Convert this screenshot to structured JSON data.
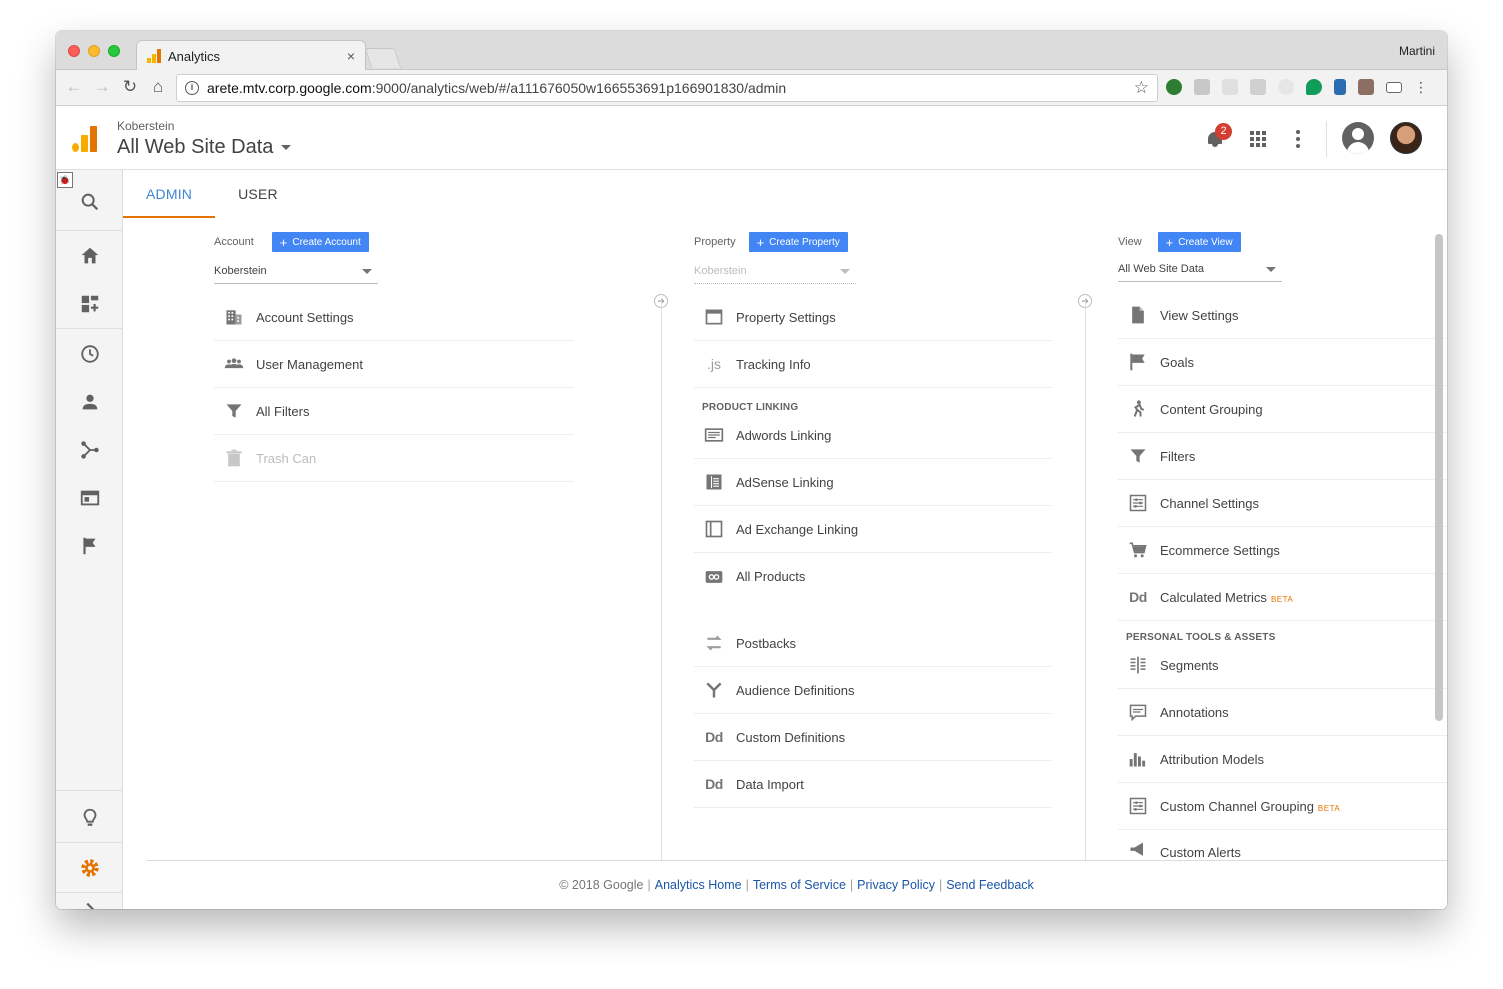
{
  "browser": {
    "tab_title": "Analytics",
    "tab_close": "×",
    "profile_name": "Martini",
    "url_host": "arete.mtv.corp.google.com",
    "url_rest": ":9000/analytics/web/#/a111676050w166553691p166901830/admin",
    "icons": [
      "back-icon",
      "forward-icon",
      "reload-icon",
      "home-icon",
      "info-icon",
      "star-icon"
    ]
  },
  "header": {
    "account_name": "Koberstein",
    "property_view": "All Web Site Data",
    "notification_count": "2"
  },
  "tabs": [
    {
      "label": "ADMIN",
      "active": true
    },
    {
      "label": "USER",
      "active": false
    }
  ],
  "account": {
    "label": "Account",
    "create_label": "Create Account",
    "selected": "Koberstein",
    "items": [
      {
        "label": "Account Settings",
        "icon": "building-icon"
      },
      {
        "label": "User Management",
        "icon": "people-icon"
      },
      {
        "label": "All Filters",
        "icon": "filter-icon"
      },
      {
        "label": "Trash Can",
        "icon": "trash-icon",
        "disabled": true
      }
    ]
  },
  "property": {
    "label": "Property",
    "create_label": "Create Property",
    "selected": "Koberstein",
    "items": [
      {
        "label": "Property Settings",
        "icon": "window-icon"
      },
      {
        "label": "Tracking Info",
        "icon": "js-icon"
      }
    ],
    "section_label": "PRODUCT LINKING",
    "linking": [
      {
        "label": "Adwords Linking",
        "icon": "adwords-icon"
      },
      {
        "label": "AdSense Linking",
        "icon": "adsense-icon"
      },
      {
        "label": "Ad Exchange Linking",
        "icon": "adexchange-icon"
      },
      {
        "label": "All Products",
        "icon": "link-icon"
      }
    ],
    "more": [
      {
        "label": "Postbacks",
        "icon": "postback-icon"
      },
      {
        "label": "Audience Definitions",
        "icon": "audience-icon"
      },
      {
        "label": "Custom Definitions",
        "icon": "dd-icon"
      },
      {
        "label": "Data Import",
        "icon": "dd-icon"
      }
    ]
  },
  "view": {
    "label": "View",
    "create_label": "Create View",
    "selected": "All Web Site Data",
    "items": [
      {
        "label": "View Settings",
        "icon": "document-icon"
      },
      {
        "label": "Goals",
        "icon": "flag-icon"
      },
      {
        "label": "Content Grouping",
        "icon": "person-walk-icon"
      },
      {
        "label": "Filters",
        "icon": "filter-icon"
      },
      {
        "label": "Channel Settings",
        "icon": "channel-icon"
      },
      {
        "label": "Ecommerce Settings",
        "icon": "cart-icon"
      },
      {
        "label": "Calculated Metrics",
        "icon": "dd-icon",
        "badge": "BETA"
      }
    ],
    "section_label": "PERSONAL TOOLS & ASSETS",
    "tools": [
      {
        "label": "Segments",
        "icon": "segments-icon"
      },
      {
        "label": "Annotations",
        "icon": "comment-icon"
      },
      {
        "label": "Attribution Models",
        "icon": "bars-icon"
      },
      {
        "label": "Custom Channel Grouping",
        "icon": "channel-icon",
        "badge": "BETA"
      },
      {
        "label": "Custom Alerts",
        "icon": "megaphone-icon"
      }
    ]
  },
  "footer": {
    "copyright": "© 2018 Google",
    "links": [
      "Analytics Home",
      "Terms of Service",
      "Privacy Policy",
      "Send Feedback"
    ]
  },
  "colors": {
    "accent_blue": "#4285f4",
    "tab_active": "#3e86d0",
    "tab_underline": "#e37400",
    "beta": "#e37400",
    "gear": "#e37400",
    "badge": "#d23f31"
  }
}
